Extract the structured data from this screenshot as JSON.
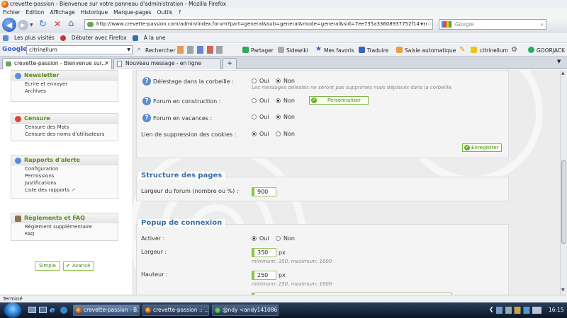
{
  "window": {
    "title": "crevette-passion - Bienvenue sur votre panneau d'administration - Mozilla Firefox"
  },
  "menu": [
    "Fichier",
    "Édition",
    "Affichage",
    "Historique",
    "Marque-pages",
    "Outils",
    "?"
  ],
  "nav": {
    "url": "http://www.crevette-passion.com/admin/index.forum?part=general&sub=general&mode=general&sid=7ee735a33608937752f143ae146f",
    "search_placeholder": "Google"
  },
  "bookmarks": [
    "Les plus visités",
    "Débuter avec Firefox",
    "À la une"
  ],
  "googlebar": {
    "brand": "Google",
    "query": "citrinellum",
    "items": [
      "Rechercher",
      "Partager",
      "Sidewiki",
      "Mes favoris",
      "Traduire",
      "Saisie automatique",
      "citrinellum",
      "GOORJACK"
    ]
  },
  "tabs": [
    {
      "label": "crevette-passion - Bienvenue sur..."
    },
    {
      "label": "Nouveau message - en ligne"
    }
  ],
  "sidebar": {
    "newsletter": {
      "title": "Newsletter",
      "links": [
        "Ecrire et envoyer",
        "Archives"
      ]
    },
    "censure": {
      "title": "Censure",
      "links": [
        "Censure des Mots",
        "Censure des noms d'utilisateurs"
      ]
    },
    "rapports": {
      "title": "Rapports d'alerte",
      "links": [
        "Configuration",
        "Permissions",
        "Justifications",
        "Liste des rapports"
      ]
    },
    "reglements": {
      "title": "Règlements et FAQ",
      "links": [
        "Règlement supplémentaire",
        "FAQ"
      ]
    },
    "mode_simple": "Simple",
    "mode_avance": "Avancé"
  },
  "general": {
    "delestage": {
      "label": "Délestage dans la corbeille :",
      "oui": "Oui",
      "non": "Non",
      "note": "Les messages délestés ne seront pas supprimés mais déplacés dans la corbeille."
    },
    "construction": {
      "label": "Forum en construction :",
      "oui": "Oui",
      "non": "Non",
      "personnaliser": "Personnaliser"
    },
    "vacances": {
      "label": "Forum en vacances :",
      "oui": "Oui",
      "non": "Non"
    },
    "cookies": {
      "label": "Lien de suppression des cookies :",
      "oui": "Oui",
      "non": "Non"
    },
    "enregistrer": "Enregistrer"
  },
  "structure": {
    "title": "Structure des pages",
    "largeur_label": "Largeur du forum (nombre ou %) :",
    "largeur_value": "900"
  },
  "popup": {
    "title": "Popup de connexion",
    "activer": {
      "label": "Activer :",
      "oui": "Oui",
      "non": "Non"
    },
    "largeur": {
      "label": "Largeur :",
      "value": "350",
      "unit": "px",
      "note": "minimum: 350, maximum: 1600"
    },
    "hauteur": {
      "label": "Hauteur :",
      "value": "250",
      "unit": "px",
      "note": "minimum: 250, maximum: 1600"
    }
  },
  "status": "Terminé",
  "taskbar": {
    "items": [
      "crevette-passion - B...",
      "crevette-passion :: ...",
      "@ndy <andy141086..."
    ],
    "clock": "16:15"
  }
}
